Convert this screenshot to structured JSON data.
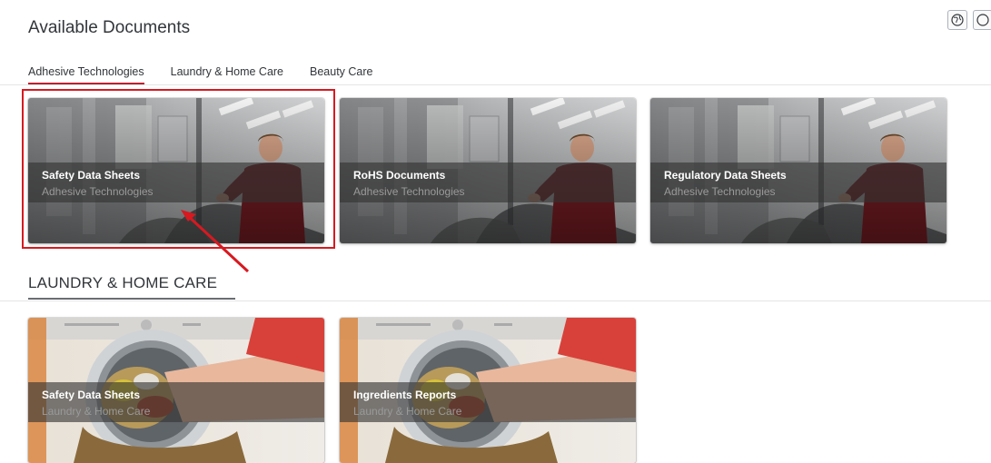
{
  "page": {
    "title": "Available Documents"
  },
  "toolbar": {
    "icons": [
      "globe-icon",
      "info-icon"
    ]
  },
  "tabs": [
    {
      "label": "Adhesive Technologies",
      "active": true
    },
    {
      "label": "Laundry & Home Care",
      "active": false
    },
    {
      "label": "Beauty Care",
      "active": false
    }
  ],
  "adhesive_tiles": [
    {
      "title": "Safety Data Sheets",
      "subtitle": "Adhesive Technologies",
      "highlighted": true
    },
    {
      "title": "RoHS Documents",
      "subtitle": "Adhesive Technologies"
    },
    {
      "title": "Regulatory Data Sheets",
      "subtitle": "Adhesive Technologies"
    }
  ],
  "laundry_section": {
    "title": "LAUNDRY & HOME CARE",
    "tiles": [
      {
        "title": "Safety Data Sheets",
        "subtitle": "Laundry & Home Care"
      },
      {
        "title": "Ingredients Reports",
        "subtitle": "Laundry & Home Care"
      }
    ]
  },
  "colors": {
    "accent": "#bf1e2d",
    "highlight": "#d71920",
    "arrow": "#d71920"
  }
}
